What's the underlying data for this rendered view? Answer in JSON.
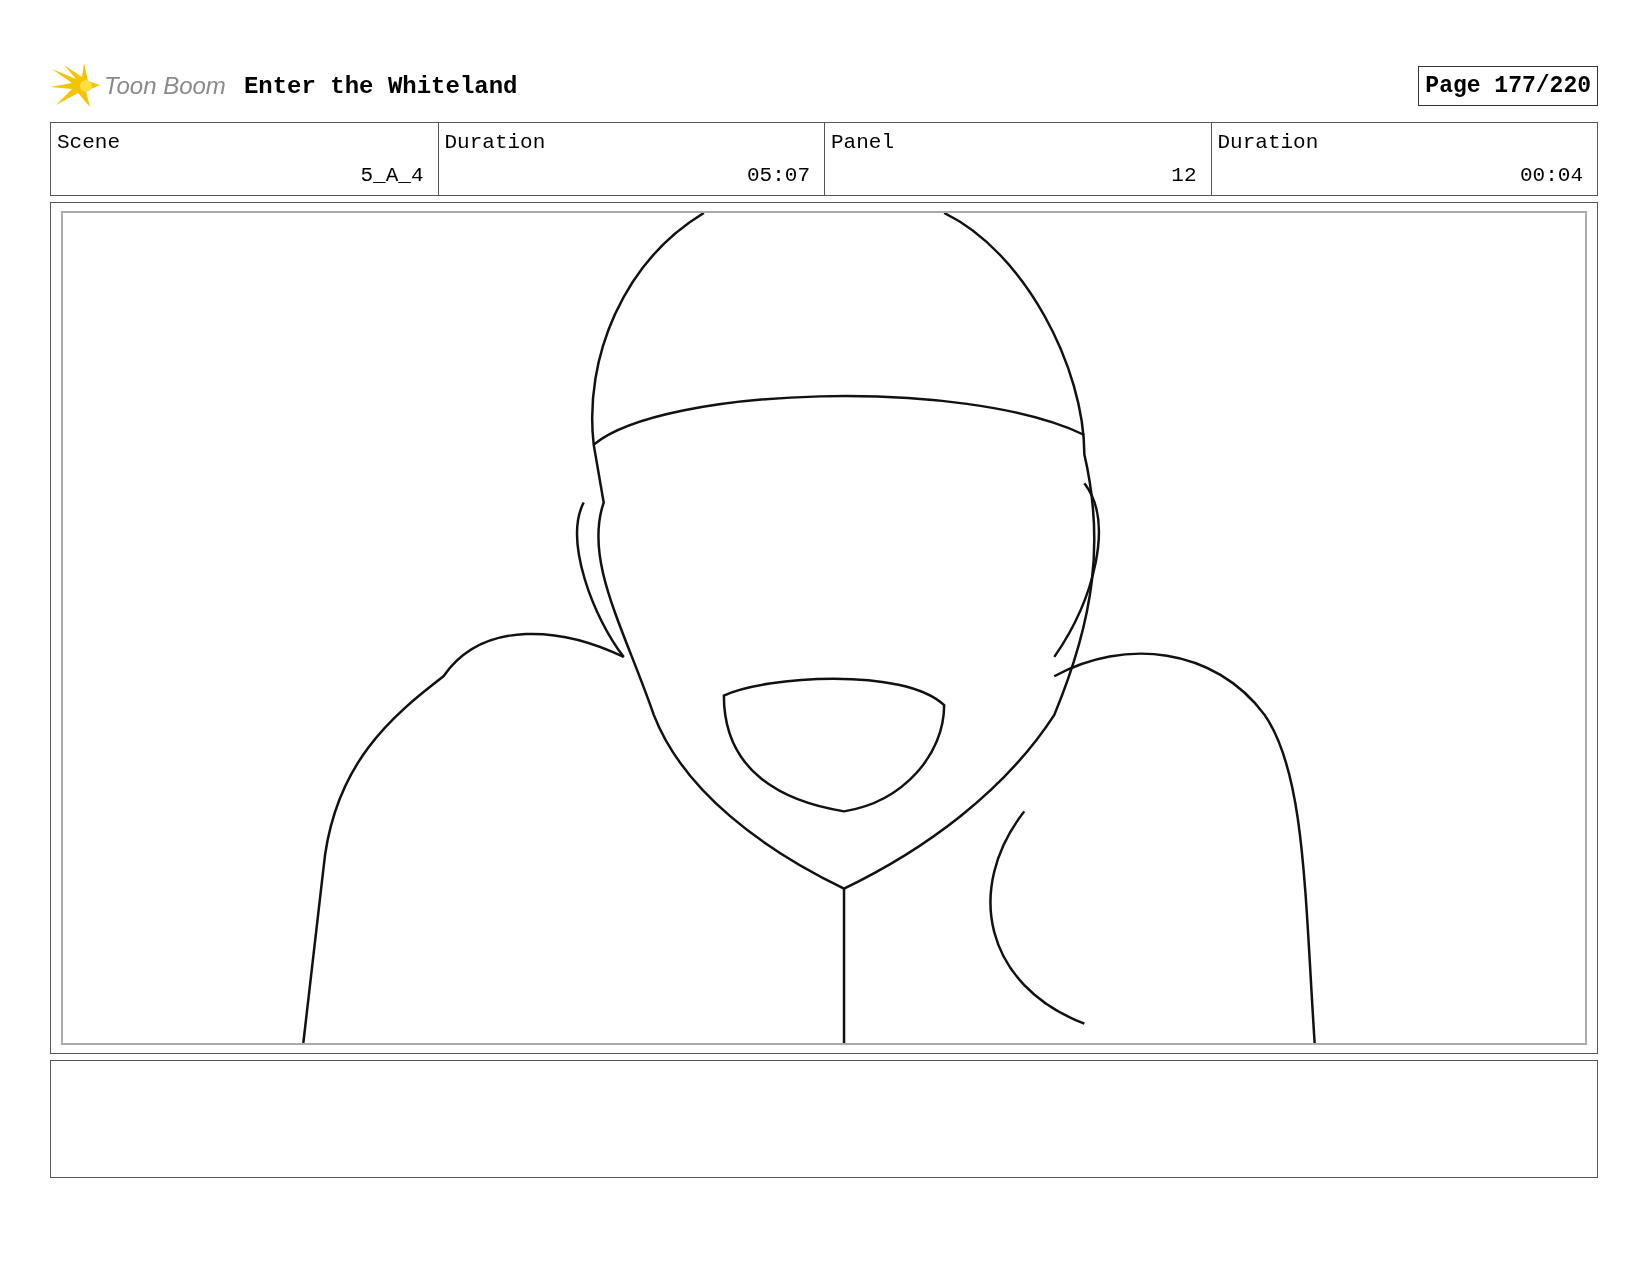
{
  "header": {
    "logo": "Toon Boom",
    "title": "Enter the Whiteland",
    "page": "Page 177/220"
  },
  "fields": [
    {
      "label": "Scene",
      "value": "5_A_4"
    },
    {
      "label": "Duration",
      "value": "05:07"
    },
    {
      "label": "Panel",
      "value": "12"
    },
    {
      "label": "Duration",
      "value": "00:04"
    }
  ]
}
